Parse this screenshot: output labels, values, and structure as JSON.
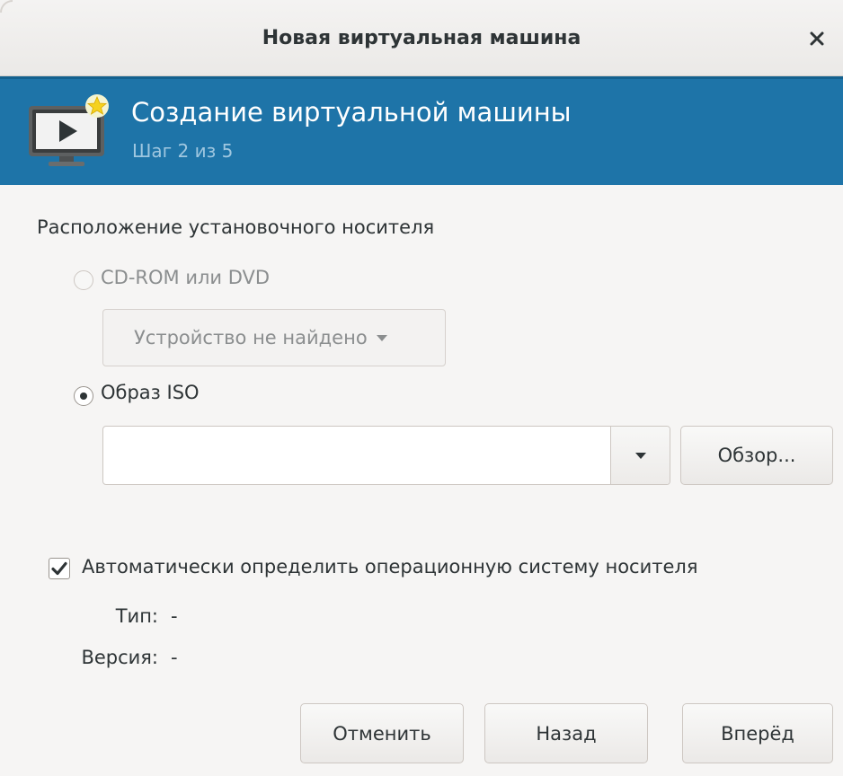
{
  "window": {
    "title": "Новая виртуальная машина"
  },
  "banner": {
    "title": "Создание виртуальной машины",
    "step": "Шаг 2 из 5",
    "icon": "monitor-play-icon"
  },
  "colors": {
    "banner_bg": "#1e74a8",
    "banner_step_text": "#9fc7e0",
    "window_bg": "#f6f5f4"
  },
  "install_media": {
    "section_label": "Расположение установочного носителя",
    "cdrom": {
      "label": "CD-ROM или DVD",
      "selected": false,
      "enabled": false,
      "device_value": "Устройство не найдено"
    },
    "iso": {
      "label": "Образ ISO",
      "selected": true,
      "path_value": "",
      "browse_label": "Обзор..."
    }
  },
  "os_detect": {
    "checkbox_label": "Автоматически определить операционную систему носителя",
    "checked": true,
    "type_label": "Тип:",
    "type_value": "-",
    "version_label": "Версия:",
    "version_value": "-"
  },
  "footer": {
    "cancel_label": "Отменить",
    "back_label": "Назад",
    "forward_label": "Вперёд"
  }
}
